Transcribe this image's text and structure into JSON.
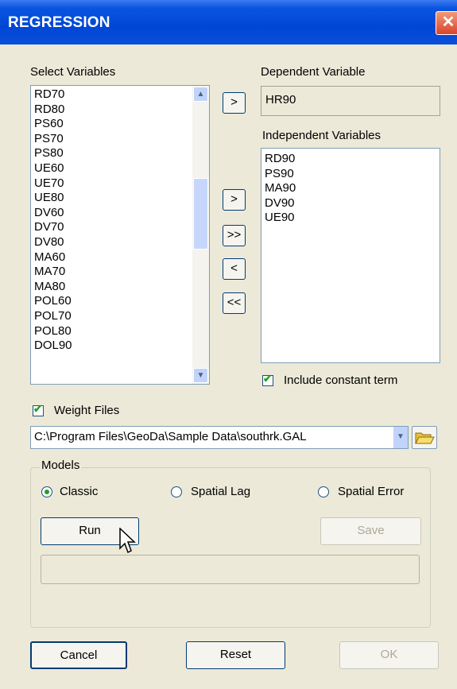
{
  "window": {
    "title": "REGRESSION",
    "close_glyph": "✕"
  },
  "select_variables": {
    "label": "Select Variables",
    "items": [
      "RD70",
      "RD80",
      "PS60",
      "PS70",
      "PS80",
      "UE60",
      "UE70",
      "UE80",
      "DV60",
      "DV70",
      "DV80",
      "MA60",
      "MA70",
      "MA80",
      "POL60",
      "POL70",
      "POL80",
      "DOL90"
    ]
  },
  "dependent": {
    "label": "Dependent Variable",
    "value": "HR90"
  },
  "independent": {
    "label": "Independent Variables",
    "items": [
      "RD90",
      "PS90",
      "MA90",
      "DV90",
      "UE90"
    ]
  },
  "move_buttons": {
    "to_dependent": ">",
    "add": ">",
    "add_all": ">>",
    "remove": "<",
    "remove_all": "<<"
  },
  "constant_term": {
    "label": "Include constant term",
    "checked": true
  },
  "weight_files": {
    "label": "Weight Files",
    "checked": true,
    "path": "C:\\Program Files\\GeoDa\\Sample Data\\southrk.GAL"
  },
  "models": {
    "label": "Models",
    "options": [
      {
        "label": "Classic",
        "selected": true
      },
      {
        "label": "Spatial Lag",
        "selected": false
      },
      {
        "label": "Spatial Error",
        "selected": false
      }
    ],
    "run_label": "Run",
    "save_label": "Save"
  },
  "footer": {
    "cancel_label": "Cancel",
    "reset_label": "Reset",
    "ok_label": "OK"
  },
  "colors": {
    "title_bar": "#0046d5",
    "window_bg": "#ece9d8",
    "check_mark": "#21a121"
  },
  "icons": {
    "close": "close-icon",
    "folder": "open-folder-icon",
    "scroll_up": "scroll-up-icon",
    "scroll_down": "scroll-down-icon",
    "combo_arrow": "chevron-down-icon",
    "cursor": "mouse-pointer-icon"
  }
}
